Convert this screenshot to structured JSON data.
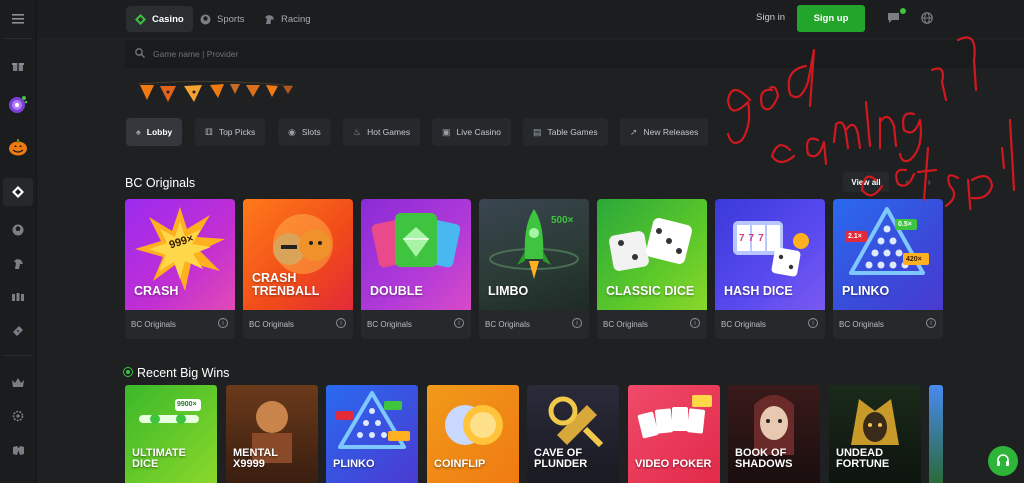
{
  "topbar": {
    "tabs": [
      {
        "label": "Casino",
        "icon": "diamond-icon"
      },
      {
        "label": "Sports",
        "icon": "soccer-ball-icon"
      },
      {
        "label": "Racing",
        "icon": "horse-icon"
      }
    ],
    "signin_label": "Sign in",
    "signup_label": "Sign up"
  },
  "search": {
    "placeholder": "Game name | Provider"
  },
  "categories": [
    {
      "label": "Lobby",
      "icon": "spade-icon"
    },
    {
      "label": "Top Picks",
      "icon": "dice-icon"
    },
    {
      "label": "Slots",
      "icon": "slots-icon"
    },
    {
      "label": "Hot Games",
      "icon": "flame-icon"
    },
    {
      "label": "Live Casino",
      "icon": "live-icon"
    },
    {
      "label": "Table Games",
      "icon": "cards-icon"
    },
    {
      "label": "New Releases",
      "icon": "rocket-icon"
    }
  ],
  "originals": {
    "title": "BC Originals",
    "view_all": "View all",
    "games": [
      {
        "name": "CRASH",
        "provider": "BC Originals",
        "badge": "999×"
      },
      {
        "name": "CRASH TRENBALL",
        "provider": "BC Originals"
      },
      {
        "name": "DOUBLE",
        "provider": "BC Originals"
      },
      {
        "name": "LIMBO",
        "provider": "BC Originals",
        "badge": "500×"
      },
      {
        "name": "CLASSIC DICE",
        "provider": "BC Originals"
      },
      {
        "name": "HASH DICE",
        "provider": "BC Originals",
        "badge": "777"
      },
      {
        "name": "PLINKO",
        "provider": "BC Originals",
        "badges": [
          "2.1×",
          "0.5×",
          "420×"
        ]
      }
    ]
  },
  "recent_wins": {
    "title": "Recent Big Wins",
    "games": [
      {
        "name": "ULTIMATE DICE",
        "badge": "9900×"
      },
      {
        "name": "MENTAL X9999"
      },
      {
        "name": "PLINKO"
      },
      {
        "name": "COINFLIP"
      },
      {
        "name": "CAVE OF PLUNDER"
      },
      {
        "name": "VIDEO POKER"
      },
      {
        "name": "BOOK OF SHADOWS"
      },
      {
        "name": "UNDEAD FORTUNE"
      }
    ]
  },
  "annotation": {
    "text": "god gambling of spil",
    "color": "#d0191f"
  },
  "colors": {
    "accent": "#22a52b",
    "background": "#1e2022",
    "panel": "#26292c"
  }
}
